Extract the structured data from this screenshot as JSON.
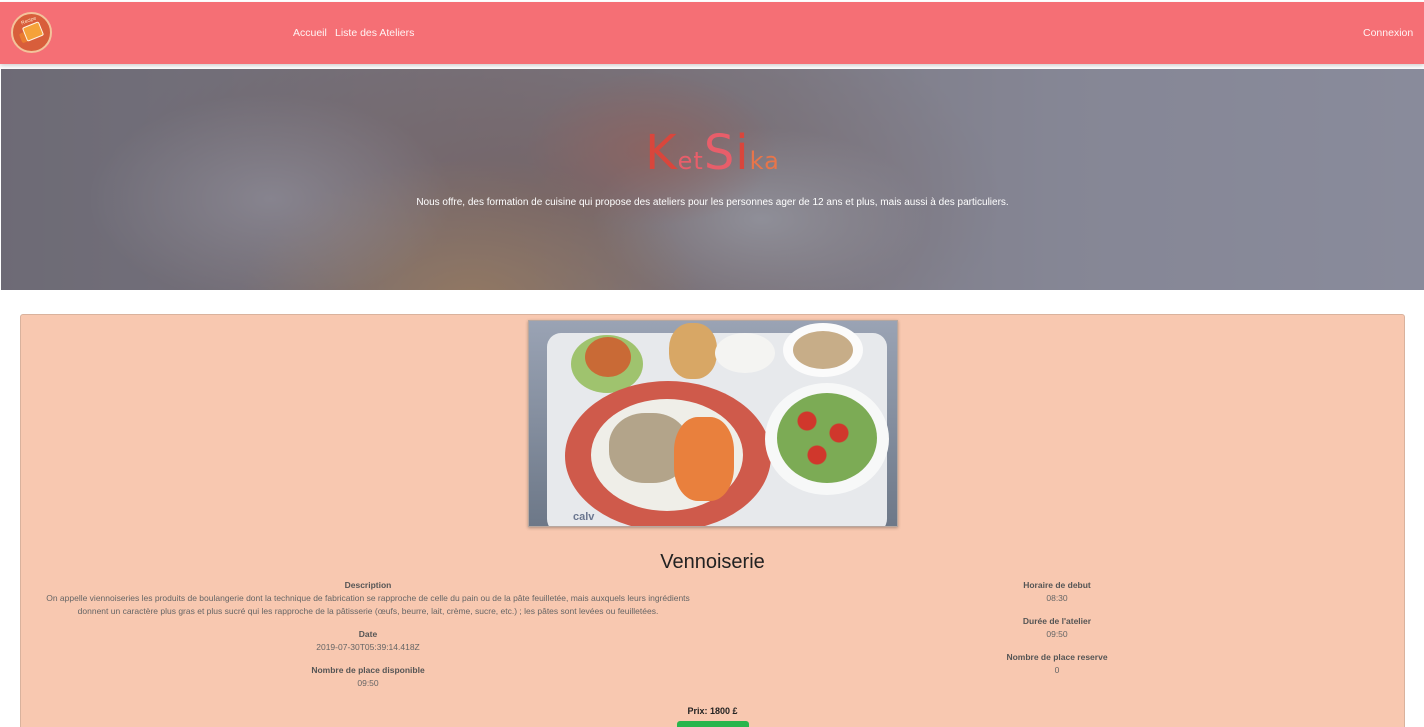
{
  "nav": {
    "logo_icon": "ketsika-book-logo",
    "logo_text": "Recipe",
    "links": [
      {
        "label": "Accueil"
      },
      {
        "label": "Liste des Ateliers"
      }
    ],
    "login": "Connexion",
    "bg_color": "#f56f75"
  },
  "hero": {
    "brand_parts": [
      {
        "text": "K",
        "color": "#d9463c",
        "size": "big"
      },
      {
        "text": "et",
        "color": "#e85e6a",
        "size": "small"
      },
      {
        "text": "S",
        "color": "#e85e6a",
        "size": "big"
      },
      {
        "text": "i",
        "color": "#d9463c",
        "size": "big"
      },
      {
        "text": "ka",
        "color": "#e8754a",
        "size": "small"
      }
    ],
    "subtitle": "Nous offre, des formation de cuisine qui propose des ateliers pour les personnes ager de 12 ans et plus, mais aussi à des particuliers."
  },
  "atelier": {
    "image_tray_brand": "calv",
    "title": "Vennoiserie",
    "description_label": "Description",
    "description": "On appelle viennoiseries les produits de boulangerie dont la technique de fabrication se rapproche de celle du pain ou de la pâte feuilletée, mais auxquels leurs ingrédients donnent un caractère plus gras et plus sucré qui les rapproche de la pâtisserie (œufs, beurre, lait, crème, sucre, etc.) ; les pâtes sont levées ou feuilletées.",
    "date_label": "Date",
    "date": "2019-07-30T05:39:14.418Z",
    "places_dispo_label": "Nombre de place disponible",
    "places_dispo": "09:50",
    "horaire_label": "Horaire de debut",
    "horaire": "08:30",
    "duree_label": "Durée de l'atelier",
    "duree": "09:50",
    "places_reserve_label": "Nombre de place reserve",
    "places_reserve": "0",
    "price": "Prix: 1800 £",
    "card_color": "#f8c8b0",
    "button_color": "#28b54c"
  }
}
